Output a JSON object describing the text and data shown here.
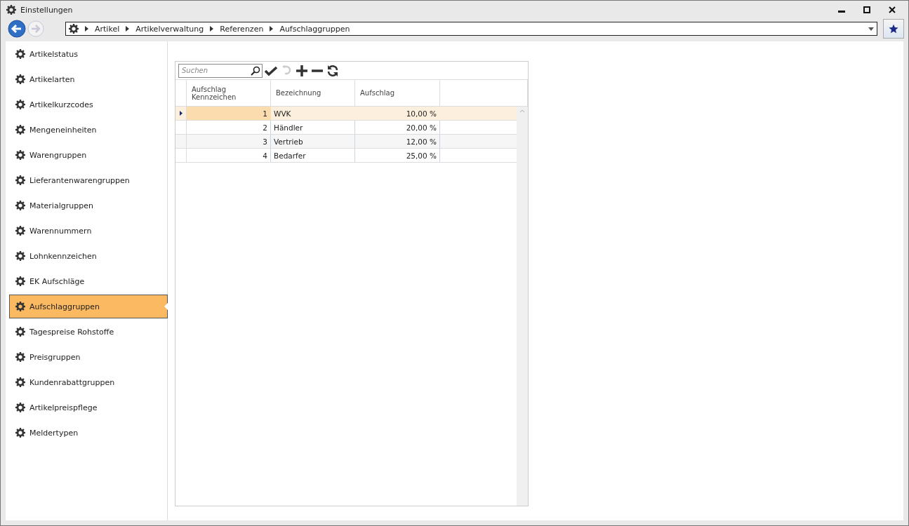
{
  "window": {
    "title": "Einstellungen"
  },
  "breadcrumb": [
    "Artikel",
    "Artikelverwaltung",
    "Referenzen",
    "Aufschlaggruppen"
  ],
  "sidebar": {
    "items": [
      {
        "label": "Artikelstatus",
        "selected": false
      },
      {
        "label": "Artikelarten",
        "selected": false
      },
      {
        "label": "Artikelkurzcodes",
        "selected": false
      },
      {
        "label": "Mengeneinheiten",
        "selected": false
      },
      {
        "label": "Warengruppen",
        "selected": false
      },
      {
        "label": "Lieferantenwarengruppen",
        "selected": false
      },
      {
        "label": "Materialgruppen",
        "selected": false
      },
      {
        "label": "Warennummern",
        "selected": false
      },
      {
        "label": "Lohnkennzeichen",
        "selected": false
      },
      {
        "label": "EK Aufschläge",
        "selected": false
      },
      {
        "label": "Aufschlaggruppen",
        "selected": true
      },
      {
        "label": "Tagespreise Rohstoffe",
        "selected": false
      },
      {
        "label": "Preisgruppen",
        "selected": false
      },
      {
        "label": "Kundenrabattgruppen",
        "selected": false
      },
      {
        "label": "Artikelpreispflege",
        "selected": false
      },
      {
        "label": "Meldertypen",
        "selected": false
      }
    ]
  },
  "search": {
    "placeholder": "Suchen"
  },
  "table": {
    "columns": [
      "Aufschlag Kennzeichen",
      "Bezeichnung",
      "Aufschlag"
    ],
    "rows": [
      {
        "cells": [
          "1",
          "WVK",
          "10,00 %"
        ],
        "selected": true
      },
      {
        "cells": [
          "2",
          "Händler",
          "20,00 %"
        ],
        "selected": false
      },
      {
        "cells": [
          "3",
          "Vertrieb",
          "12,00 %"
        ],
        "selected": false
      },
      {
        "cells": [
          "4",
          "Bedarfer",
          "25,00 %"
        ],
        "selected": false
      }
    ]
  }
}
